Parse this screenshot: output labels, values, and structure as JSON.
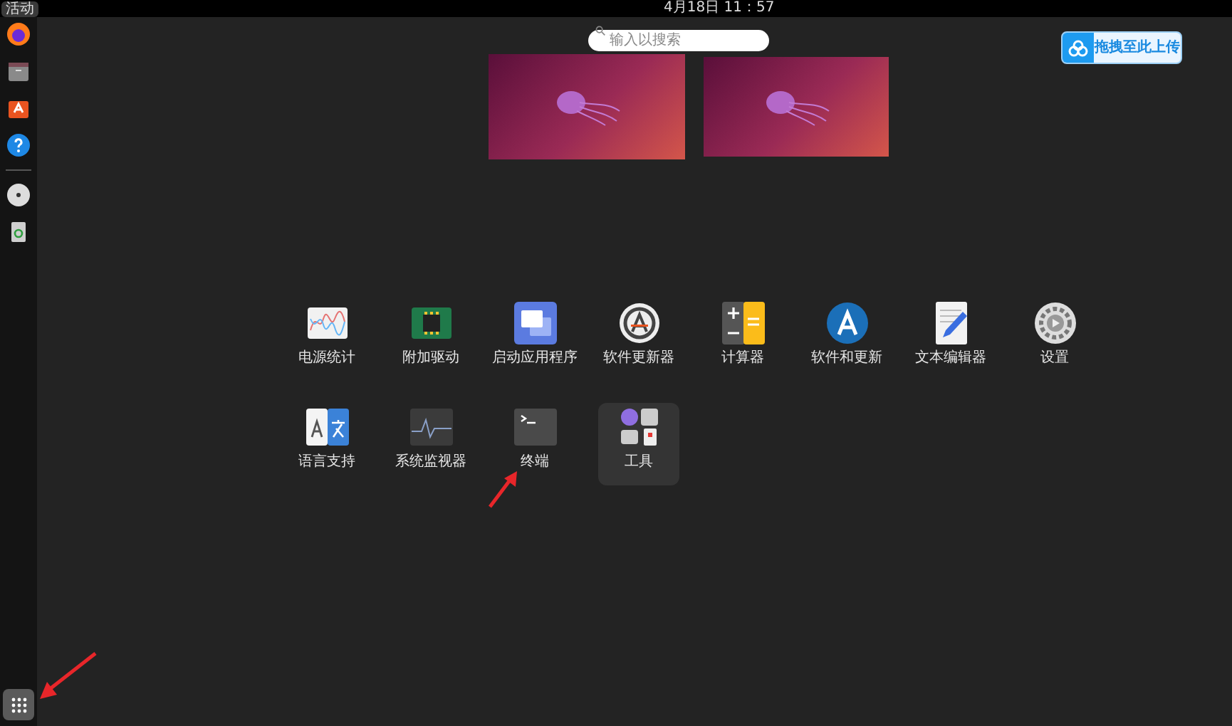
{
  "top_bar": {
    "activities": "活动",
    "clock": "4月18日 11：57"
  },
  "dock": {
    "items": [
      {
        "kind": "browser"
      },
      {
        "kind": "files"
      },
      {
        "kind": "store"
      },
      {
        "kind": "help"
      },
      {
        "kind": "divider"
      },
      {
        "kind": "disc"
      },
      {
        "kind": "trash"
      }
    ]
  },
  "search": {
    "placeholder": "输入以搜索"
  },
  "upload_button": {
    "label": "拖拽至此上传"
  },
  "workspaces": [
    {
      "selected": true
    },
    {
      "selected": false
    }
  ],
  "apps": [
    {
      "kind": "power",
      "label": "电源统计"
    },
    {
      "kind": "chip",
      "label": "附加驱动"
    },
    {
      "kind": "windows",
      "label": "启动应用程序"
    },
    {
      "kind": "updater",
      "label": "软件更新器"
    },
    {
      "kind": "calculator",
      "label": "计算器"
    },
    {
      "kind": "software",
      "label": "软件和更新"
    },
    {
      "kind": "editor",
      "label": "文本编辑器"
    },
    {
      "kind": "settings",
      "label": "设置"
    },
    {
      "kind": "language",
      "label": "语言支持"
    },
    {
      "kind": "monitor",
      "label": "系统监视器"
    },
    {
      "kind": "terminal",
      "label": "终端"
    },
    {
      "kind": "folder",
      "label": "工具"
    }
  ]
}
